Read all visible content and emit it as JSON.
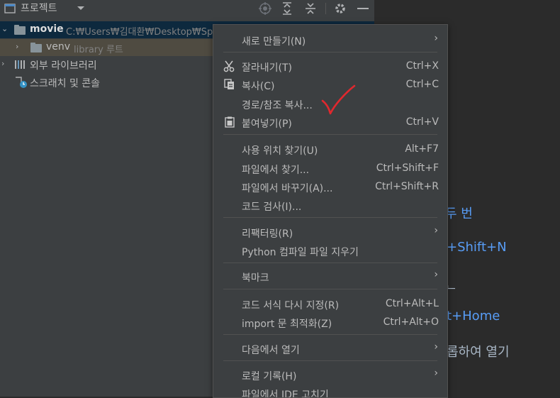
{
  "project_panel": {
    "title": "프로젝트",
    "tree": {
      "root": {
        "name": "movie",
        "path": "C:₩Users₩김대환₩Desktop₩Sp"
      },
      "venv": {
        "name": "venv",
        "tag": "library 루트"
      },
      "external_libs": "외부 라이브러리",
      "scratches": "스크래치 및 콘솔"
    }
  },
  "editor_hints": {
    "line1": "두 번",
    "line2": "+Shift+N",
    "line3": "t+Home",
    "line4": "롭하여 열기",
    "fragment": "ᆫ"
  },
  "context_menu": {
    "items": {
      "new": {
        "label": "새로 만들기(N)"
      },
      "cut": {
        "label": "잘라내기(T)",
        "shortcut": "Ctrl+X"
      },
      "copy": {
        "label": "복사(C)",
        "shortcut": "Ctrl+C"
      },
      "copy_path": {
        "label": "경로/참조 복사..."
      },
      "paste": {
        "label": "붙여넣기(P)",
        "shortcut": "Ctrl+V"
      },
      "find_usages": {
        "label": "사용 위치 찾기(U)",
        "shortcut": "Alt+F7"
      },
      "find_in_files": {
        "label": "파일에서 찾기...",
        "shortcut": "Ctrl+Shift+F"
      },
      "replace_in_files": {
        "label": "파일에서 바꾸기(A)...",
        "shortcut": "Ctrl+Shift+R"
      },
      "inspect_code": {
        "label": "코드 검사(I)..."
      },
      "refactor": {
        "label": "리팩터링(R)"
      },
      "python_clean": {
        "label": "Python 컴파일 파일 지우기"
      },
      "bookmarks": {
        "label": "북마크"
      },
      "reformat": {
        "label": "코드 서식 다시 지정(R)",
        "shortcut": "Ctrl+Alt+L"
      },
      "optimize_imports": {
        "label": "import 문 최적화(Z)",
        "shortcut": "Ctrl+Alt+O"
      },
      "open_in": {
        "label": "다음에서 열기"
      },
      "local_history": {
        "label": "로컬 기록(H)"
      },
      "repair_ide": {
        "label": "파일에서 IDE 고치기"
      }
    }
  },
  "colors": {
    "panel_bg": "#3c3f41",
    "editor_bg": "#2b2b2b",
    "selection": "#0d293e",
    "hint_blue": "#589df6",
    "annotation_red": "#e0282e"
  }
}
